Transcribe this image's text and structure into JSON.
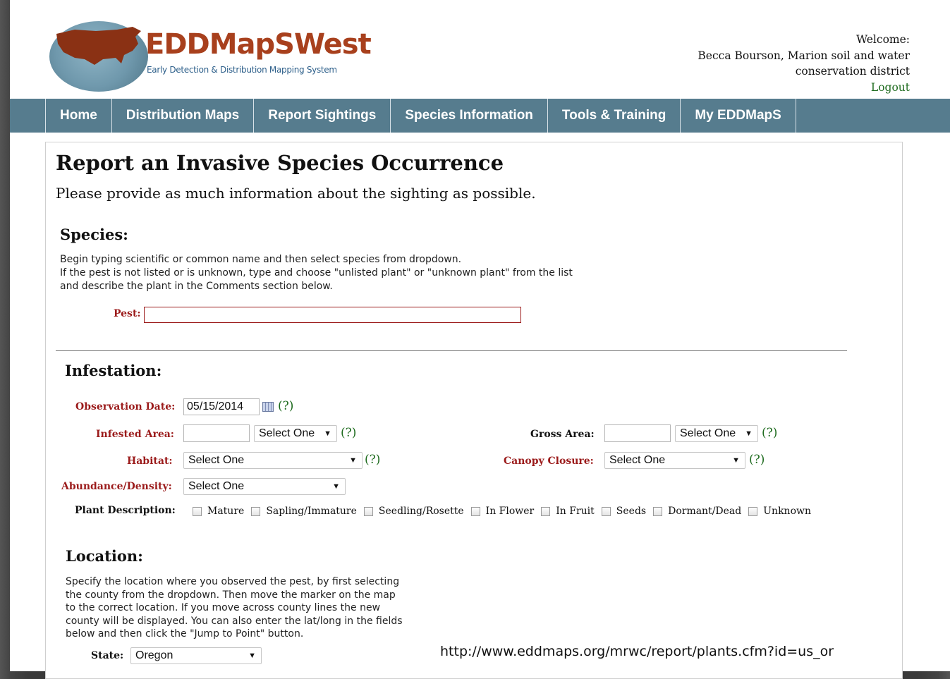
{
  "header": {
    "logo_title": "EDDMapSWest",
    "logo_subtitle": "Early Detection & Distribution Mapping System",
    "welcome_label": "Welcome:",
    "user_line1": "Becca Bourson, Marion soil and water",
    "user_line2": "conservation district",
    "logout_label": "Logout"
  },
  "nav": {
    "items": [
      "Home",
      "Distribution Maps",
      "Report Sightings",
      "Species Information",
      "Tools & Training",
      "My EDDMapS"
    ]
  },
  "page": {
    "title": "Report an Invasive Species Occurrence",
    "intro": "Please provide as much information about the sighting as possible."
  },
  "species": {
    "heading": "Species:",
    "help_line1": "Begin typing scientific or common name and then select species from dropdown.",
    "help_line2": "If the pest is not listed or is unknown, type and choose \"unlisted plant\" or \"unknown plant\" from the list",
    "help_line3": "and describe the plant in the Comments section below.",
    "pest_label": "Pest:",
    "pest_value": ""
  },
  "infestation": {
    "heading": "Infestation:",
    "help_text": "(?)",
    "observation_date_label": "Observation Date:",
    "observation_date_value": "05/15/2014",
    "infested_area_label": "Infested Area:",
    "infested_area_value": "",
    "infested_area_unit": "Select One",
    "gross_area_label": "Gross Area:",
    "gross_area_value": "",
    "gross_area_unit": "Select One",
    "habitat_label": "Habitat:",
    "habitat_value": "Select One",
    "canopy_label": "Canopy Closure:",
    "canopy_value": "Select One",
    "abundance_label": "Abundance/Density:",
    "abundance_value": "Select One",
    "plant_description_label": "Plant Description:",
    "plant_description_options": [
      "Mature",
      "Sapling/Immature",
      "Seedling/Rosette",
      "In Flower",
      "In Fruit",
      "Seeds",
      "Dormant/Dead",
      "Unknown"
    ]
  },
  "location": {
    "heading": "Location:",
    "help_line1": "Specify the location where you observed the pest, by first selecting",
    "help_line2": "the county from the dropdown. Then move the marker on the map",
    "help_line3": "to the correct location. If you move across county lines the new",
    "help_line4": "county will be displayed. You can also enter the lat/long in the fields",
    "help_line5": "below and then click the \"Jump to Point\" button.",
    "state_label": "State:",
    "state_value": "Oregon"
  },
  "footer_url": "http://www.eddmaps.org/mrwc/report/plants.cfm?id=us_or",
  "colors": {
    "nav_bg": "#567c8e",
    "required_label": "#9b1b1b",
    "help_link": "#1e6b1e",
    "logo_brand": "#a8401d"
  }
}
